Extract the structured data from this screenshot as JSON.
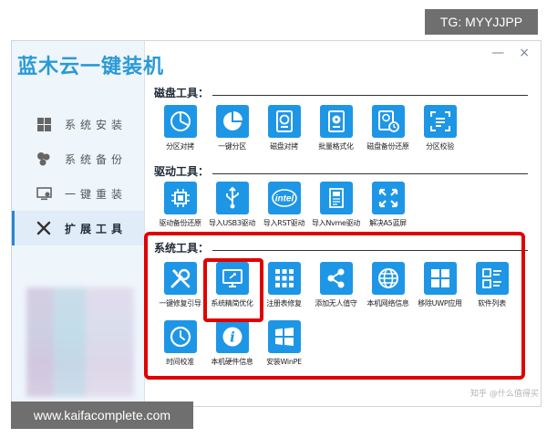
{
  "window": {
    "logo": "蓝木云一键装机",
    "controls": {
      "minimize": "—",
      "close": "×"
    }
  },
  "sidebar": {
    "items": [
      {
        "label": "系统安装",
        "icon": "windows-icon",
        "active": false
      },
      {
        "label": "系统备份",
        "icon": "backup-icon",
        "active": false
      },
      {
        "label": "一键重装",
        "icon": "monitor-icon",
        "active": false
      },
      {
        "label": "扩展工具",
        "icon": "tools-icon",
        "active": true
      }
    ]
  },
  "sections": [
    {
      "title": "磁盘工具：",
      "tools": [
        {
          "label": "分区对拷",
          "icon": "partition-copy-icon"
        },
        {
          "label": "一键分区",
          "icon": "pie-partition-icon"
        },
        {
          "label": "磁盘对拷",
          "icon": "disk-copy-icon"
        },
        {
          "label": "批量格式化",
          "icon": "format-icon"
        },
        {
          "label": "磁盘备份还原",
          "icon": "disk-backup-icon"
        },
        {
          "label": "分区校验",
          "icon": "partition-check-icon"
        }
      ]
    },
    {
      "title": "驱动工具：",
      "tools": [
        {
          "label": "驱动备份还原",
          "icon": "chip-icon"
        },
        {
          "label": "导入USB3驱动",
          "icon": "usb-icon"
        },
        {
          "label": "导入RST驱动",
          "icon": "intel-icon"
        },
        {
          "label": "导入Nvme驱动",
          "icon": "nvme-icon"
        },
        {
          "label": "解决A5蓝屏",
          "icon": "expand-icon"
        }
      ]
    },
    {
      "title": "系统工具：",
      "tools": [
        {
          "label": "一键修复引导",
          "icon": "repair-tools-icon"
        },
        {
          "label": "系统精简优化",
          "icon": "optimize-monitor-icon"
        },
        {
          "label": "注册表修复",
          "icon": "registry-grid-icon"
        },
        {
          "label": "添加无人值守",
          "icon": "share-nodes-icon"
        },
        {
          "label": "本机网络信息",
          "icon": "globe-icon"
        },
        {
          "label": "移除UWP应用",
          "icon": "uwp-grid-icon"
        },
        {
          "label": "软件列表",
          "icon": "list-icon"
        },
        {
          "label": "时间校准",
          "icon": "clock-icon"
        },
        {
          "label": "本机硬件信息",
          "icon": "info-icon"
        },
        {
          "label": "安装WinPE",
          "icon": "winpe-icon"
        }
      ]
    }
  ],
  "overlays": {
    "tg_label": "TG: MYYJJPP",
    "url_label": "www.kaifacomplete.com",
    "zhihu_mark": "知乎 @什么值得买"
  },
  "colors": {
    "accent": "#1e96e6",
    "highlight_red": "#e00000",
    "sidebar_bg": "#eef5fb",
    "logo": "#2a9ad6"
  }
}
